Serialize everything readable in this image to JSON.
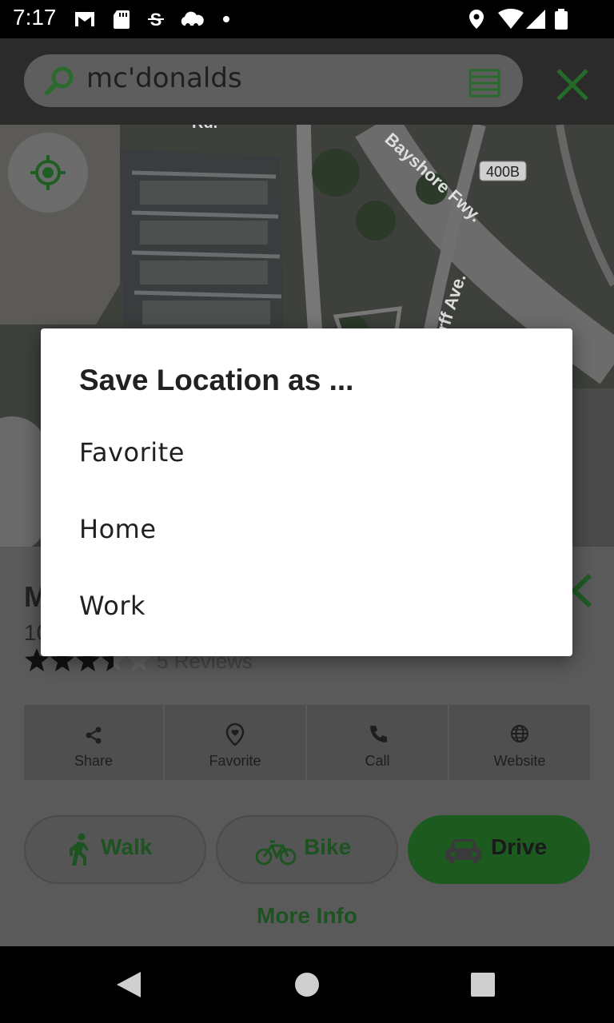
{
  "status_bar": {
    "time": "7:17",
    "left_icons": [
      "gmail-icon",
      "sd-card-icon",
      "sync-icon",
      "cloud-icon",
      "dot-icon"
    ],
    "right_icons": [
      "location-icon",
      "wifi-icon",
      "signal-icon",
      "battery-icon"
    ]
  },
  "search": {
    "query": "mc'donalds",
    "icons": [
      "search-icon",
      "list-icon",
      "close-icon"
    ]
  },
  "map": {
    "labels": {
      "highway": "Bayshore Fwy.",
      "avenue": "rff Ave.",
      "shield": "400B",
      "road": "Rd."
    },
    "locate_icon": "my-location-icon"
  },
  "place": {
    "name_partial": "M",
    "address_partial": "10",
    "rating": 3.5,
    "reviews": "5 Reviews",
    "actions": [
      {
        "label": "Share",
        "icon": "share-icon"
      },
      {
        "label": "Favorite",
        "icon": "heart-pin-icon"
      },
      {
        "label": "Call",
        "icon": "phone-icon"
      },
      {
        "label": "Website",
        "icon": "globe-icon"
      }
    ],
    "modes": [
      {
        "label": "Walk",
        "icon": "walk-icon"
      },
      {
        "label": "Bike",
        "icon": "bike-icon"
      },
      {
        "label": "Drive",
        "icon": "car-icon"
      }
    ],
    "more_info": "More Info"
  },
  "dialog": {
    "title": "Save Location as ...",
    "options": [
      "Favorite",
      "Home",
      "Work"
    ]
  },
  "colors": {
    "accent_green": "#2e7d32",
    "dim_overlay": "rgba(0,0,0,0.6)"
  }
}
